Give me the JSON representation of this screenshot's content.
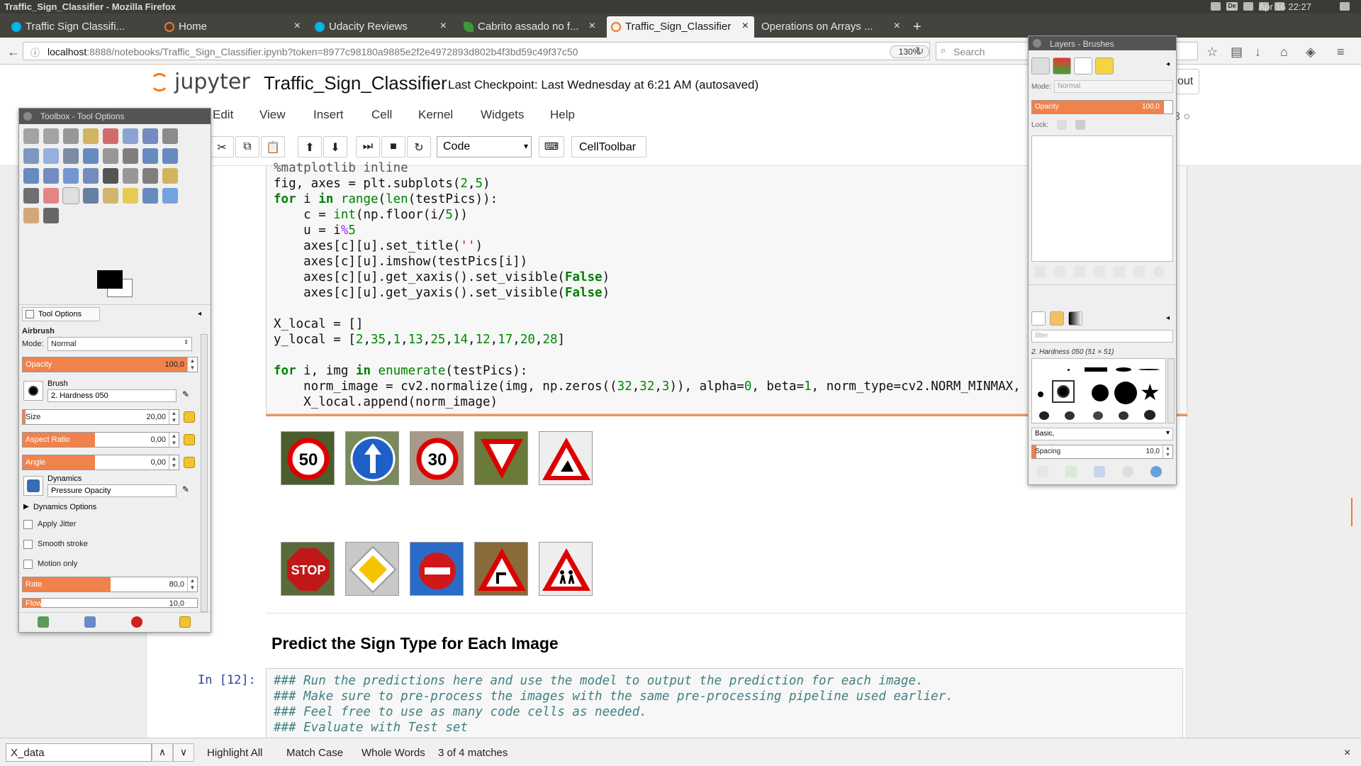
{
  "window": {
    "title": "Traffic_Sign_Classifier - Mozilla Firefox",
    "clock": "Apr 16 22:27",
    "keyboard_layout": "De"
  },
  "tabs": [
    {
      "label": "Traffic Sign Classifi...",
      "icon": "udacity-icon",
      "active": false
    },
    {
      "label": "Home",
      "icon": "jupyter-icon",
      "active": false
    },
    {
      "label": "Udacity Reviews",
      "icon": "udacity-icon",
      "active": false
    },
    {
      "label": "Cabrito assado no f...",
      "icon": "leaf-icon",
      "active": false
    },
    {
      "label": "Traffic_Sign_Classifier",
      "icon": "jupyter-icon",
      "active": true
    },
    {
      "label": "Operations on Arrays ...",
      "icon": "",
      "active": false
    }
  ],
  "nav": {
    "url_host": "localhost",
    "url_rest": ":8888/notebooks/Traffic_Sign_Classifier.ipynb?token=8977c98180a9885e2f2e4972893d802b4f3bd59c49f37c50",
    "zoom": "130%",
    "search_placeholder": "Search"
  },
  "jupyter": {
    "logo_text": "jupyter",
    "notebook_name": "Traffic_Sign_Classifier",
    "checkpoint": "Last Checkpoint: Last Wednesday at 6:21 AM (autosaved)",
    "logout_label": "out",
    "menu": [
      "Edit",
      "View",
      "Insert",
      "Cell",
      "Kernel",
      "Widgets",
      "Help"
    ],
    "cell_type": "Code",
    "celltoolbar_label": "CellToolbar"
  },
  "heading": "Predict the Sign Type for Each Image",
  "prompt2": "In [12]:",
  "code2_lines": [
    "### Run the predictions here and use the model to output the prediction for each image.",
    "### Make sure to pre-process the images with the same pre-processing pipeline used earlier.",
    "### Feel free to use as many code cells as needed.",
    "### Evaluate with Test set"
  ],
  "sign_images": [
    "speed-limit-50",
    "ahead-only",
    "speed-limit-30",
    "yield",
    "road-work",
    "stop",
    "priority-road",
    "no-entry",
    "dangerous-curve-right",
    "children-crossing"
  ],
  "findbar": {
    "query": "X_data",
    "highlight_all": "Highlight All",
    "match_case": "Match Case",
    "whole_words": "Whole Words",
    "status": "3 of 4 matches"
  },
  "toolbox": {
    "title": "Toolbox - Tool Options",
    "tab_label": "Tool Options",
    "tool_name": "Airbrush",
    "mode_label": "Mode:",
    "mode_value": "Normal",
    "opacity_label": "Opacity",
    "opacity_value": "100,0",
    "brush_label": "Brush",
    "brush_value": "2. Hardness 050",
    "size_label": "Size",
    "size_value": "20,00",
    "aspect_label": "Aspect Ratio",
    "aspect_value": "0,00",
    "angle_label": "Angle",
    "angle_value": "0,00",
    "dynamics_label": "Dynamics",
    "dynamics_value": "Pressure Opacity",
    "dynamics_options": "Dynamics Options",
    "apply_jitter": "Apply Jitter",
    "smooth_stroke": "Smooth stroke",
    "motion_only": "Motion only",
    "rate_label": "Rate",
    "rate_value": "80,0",
    "flow_label": "Flow",
    "flow_value": "10,0"
  },
  "layers": {
    "title": "Layers - Brushes",
    "mode_label": "Mode:",
    "mode_value": "Normal",
    "opacity_label": "Opacity",
    "opacity_value": "100,0",
    "lock_label": "Lock:",
    "filter_placeholder": "filter",
    "brush_name": "2. Hardness 050 (51 × 51)",
    "brush_set": "Basic,",
    "spacing_label": "Spacing",
    "spacing_value": "10,0"
  }
}
